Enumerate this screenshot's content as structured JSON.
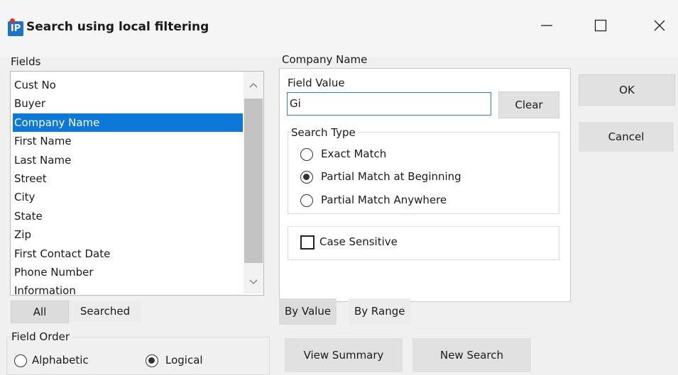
{
  "window": {
    "title": "Search using local filtering",
    "icon_text": "IP"
  },
  "fields_panel": {
    "label": "Fields",
    "items": [
      "Cust No",
      "Buyer",
      "Company Name",
      "First Name",
      "Last Name",
      "Street",
      "City",
      "State",
      "Zip",
      "First Contact Date",
      "Phone Number",
      "Information"
    ],
    "selected": "Company Name",
    "all_button": "All",
    "searched_button": "Searched"
  },
  "field_order": {
    "label": "Field Order",
    "options": [
      "Alphabetic",
      "Logical"
    ],
    "selected": "Logical"
  },
  "right_panel": {
    "heading": "Company Name",
    "field_value_label": "Field Value",
    "field_value": "Gi",
    "clear_button": "Clear",
    "search_type_label": "Search Type",
    "search_types": [
      "Exact Match",
      "Partial Match at Beginning",
      "Partial Match Anywhere"
    ],
    "search_type_selected": "Partial Match at Beginning",
    "case_sensitive_label": "Case Sensitive",
    "case_sensitive_checked": false,
    "tabs": [
      "By Value",
      "By Range"
    ],
    "active_tab": "By Value"
  },
  "buttons": {
    "ok": "OK",
    "cancel": "Cancel",
    "view_summary": "View Summary",
    "new_search": "New Search"
  }
}
